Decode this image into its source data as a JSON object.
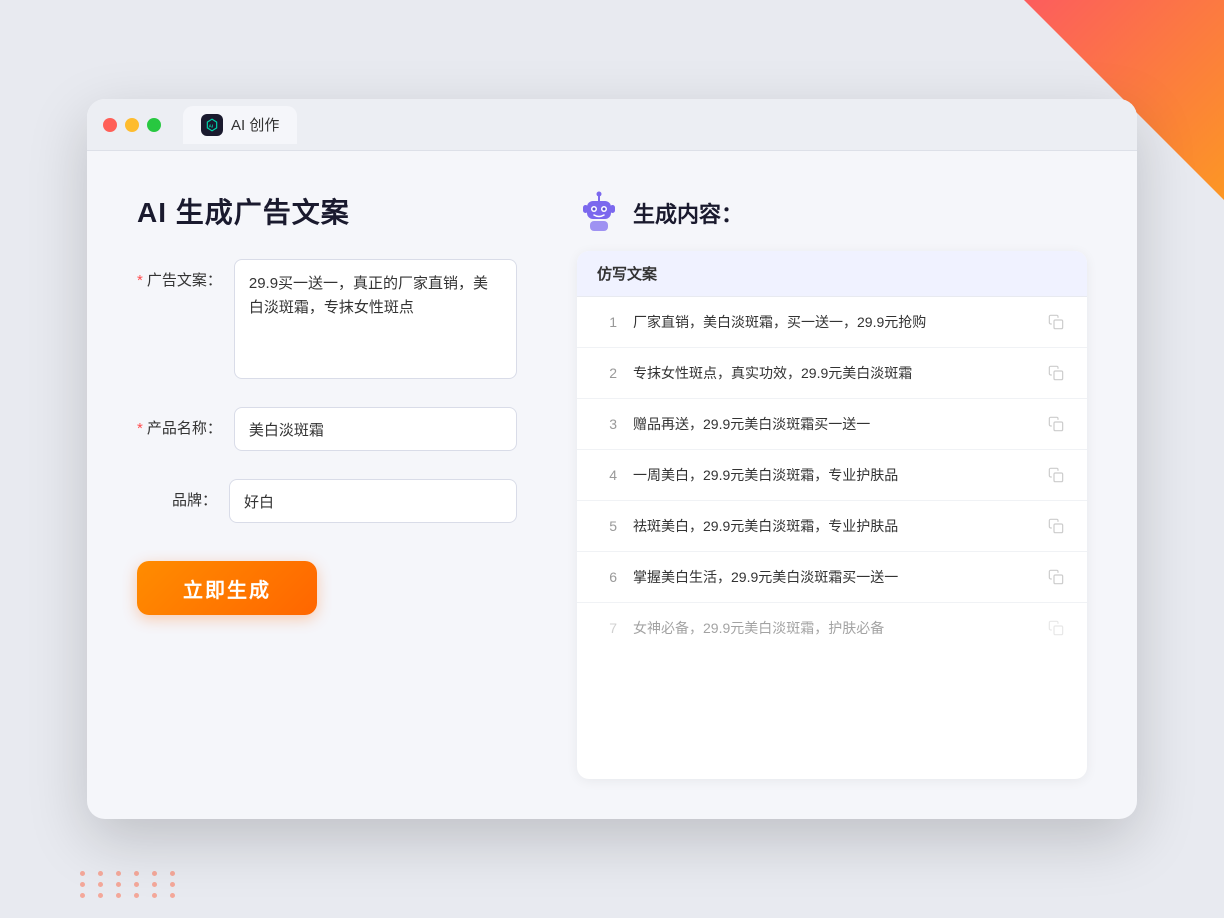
{
  "window": {
    "tab_label": "AI 创作"
  },
  "left_panel": {
    "title": "AI 生成广告文案",
    "form": {
      "ad_copy_label": "广告文案：",
      "ad_copy_placeholder": "29.9买一送一，真正的厂家直销，美白淡斑霜，专抹女性斑点",
      "ad_copy_value": "29.9买一送一，真正的厂家直销，美白淡斑霜，专抹女性斑点",
      "product_name_label": "产品名称：",
      "product_name_value": "美白淡斑霜",
      "brand_label": "品牌：",
      "brand_value": "好白"
    },
    "generate_button_label": "立即生成"
  },
  "right_panel": {
    "title": "生成内容：",
    "table_header": "仿写文案",
    "results": [
      {
        "num": "1",
        "text": "厂家直销，美白淡斑霜，买一送一，29.9元抢购",
        "faded": false
      },
      {
        "num": "2",
        "text": "专抹女性斑点，真实功效，29.9元美白淡斑霜",
        "faded": false
      },
      {
        "num": "3",
        "text": "赠品再送，29.9元美白淡斑霜买一送一",
        "faded": false
      },
      {
        "num": "4",
        "text": "一周美白，29.9元美白淡斑霜，专业护肤品",
        "faded": false
      },
      {
        "num": "5",
        "text": "祛斑美白，29.9元美白淡斑霜，专业护肤品",
        "faded": false
      },
      {
        "num": "6",
        "text": "掌握美白生活，29.9元美白淡斑霜买一送一",
        "faded": false
      },
      {
        "num": "7",
        "text": "女神必备，29.9元美白淡斑霜，护肤必备",
        "faded": true
      }
    ]
  },
  "icons": {
    "copy": "copy-icon",
    "robot": "robot-icon",
    "ai_badge": "ai-badge-icon"
  }
}
